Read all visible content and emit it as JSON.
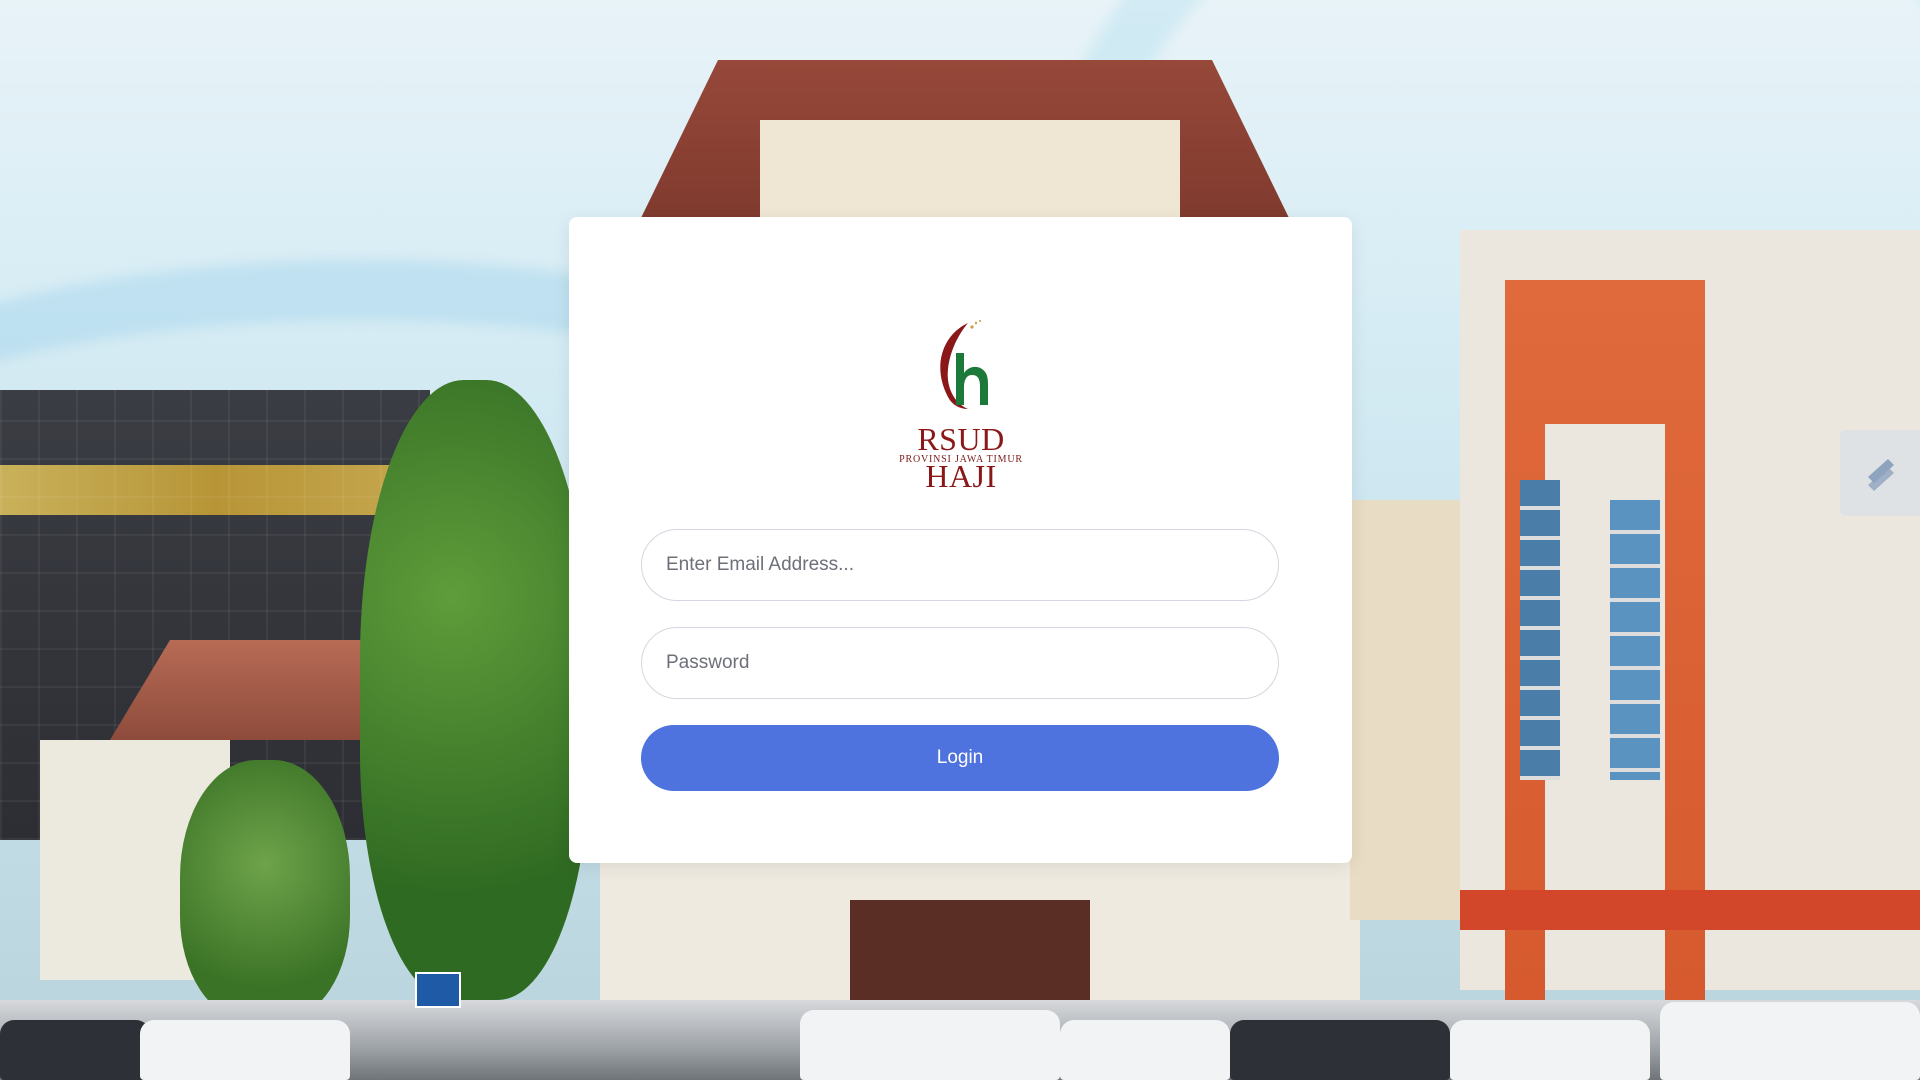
{
  "login": {
    "logo": {
      "title": "RSUD HAJI",
      "subtitle": "PROVINSI JAWA TIMUR",
      "icon": "rsud-haji-h-logo-icon"
    },
    "email_placeholder": "Enter Email Address...",
    "password_placeholder": "Password",
    "login_label": "Login"
  },
  "colors": {
    "button": "#4e73df",
    "card": "#ffffff",
    "logo_red": "#8a1818",
    "logo_green": "#1b7a3a"
  },
  "background": {
    "description_icon": "hospital-building-photo"
  },
  "side_widget": {
    "icon": "slider-toggle-icon"
  }
}
